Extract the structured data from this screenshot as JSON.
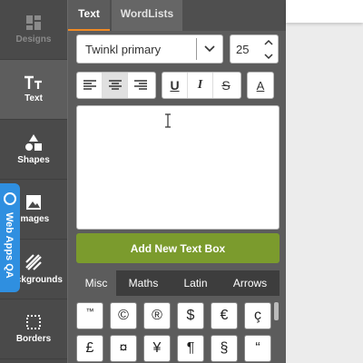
{
  "sidebar": {
    "items": [
      {
        "label": "Designs",
        "icon": "grid-icon"
      },
      {
        "label": "Text",
        "icon": "text-tt-icon"
      },
      {
        "label": "Shapes",
        "icon": "shapes-icon"
      },
      {
        "label": "Images",
        "icon": "image-icon"
      },
      {
        "label": "Backgrounds",
        "icon": "backgrounds-icon"
      },
      {
        "label": "Borders",
        "icon": "border-icon"
      }
    ]
  },
  "qa_tab": {
    "label": "Web Apps QA"
  },
  "panel": {
    "tabs": [
      {
        "label": "Text"
      },
      {
        "label": "WordLists"
      }
    ],
    "font_select": {
      "value": "Twinkl primary"
    },
    "font_size": {
      "value": "25"
    },
    "add_button": {
      "label": "Add New Text Box"
    },
    "symbol_tabs": [
      {
        "label": "Misc"
      },
      {
        "label": "Maths"
      },
      {
        "label": "Latin"
      },
      {
        "label": "Arrows"
      }
    ],
    "symbols": [
      "™",
      "©",
      "®",
      "$",
      "€",
      "ç",
      "£",
      "¤",
      "¥",
      "¶",
      "§",
      "“"
    ],
    "format_buttons": [
      {
        "name": "align-left-button"
      },
      {
        "name": "align-center-button"
      },
      {
        "name": "align-right-button"
      },
      {
        "name": "underline-button",
        "glyph": "U"
      },
      {
        "name": "italic-button",
        "glyph": "I"
      },
      {
        "name": "strikethrough-button",
        "glyph": "S"
      },
      {
        "name": "text-color-button",
        "glyph": "A"
      }
    ]
  },
  "colors": {
    "accent_tab": "#f08a24",
    "add_button": "#7b9b2d",
    "qa_tab": "#2f8fe0"
  }
}
